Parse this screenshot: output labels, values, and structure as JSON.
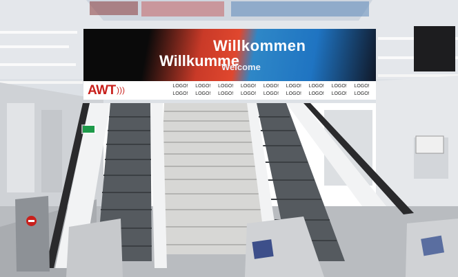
{
  "banner": {
    "headline_1": "Willkommen",
    "headline_2": "Willkumme",
    "headline_3": "Welcome",
    "brand": "AWT",
    "logos": [
      "LOGO!",
      "LOGO!",
      "LOGO!",
      "LOGO!",
      "LOGO!",
      "LOGO!",
      "LOGO!",
      "LOGO!",
      "LOGO!",
      "LOGO!",
      "LOGO!",
      "LOGO!",
      "LOGO!",
      "LOGO!",
      "LOGO!",
      "LOGO!",
      "LOGO!",
      "LOGO!"
    ]
  },
  "colors": {
    "banner_red": "#e0472e",
    "banner_blue": "#1f74c2",
    "brand_red": "#c8201c",
    "exit_green": "#1e9a4a"
  },
  "icons": [
    "do-not-enter-icon",
    "exit-sign-icon"
  ]
}
